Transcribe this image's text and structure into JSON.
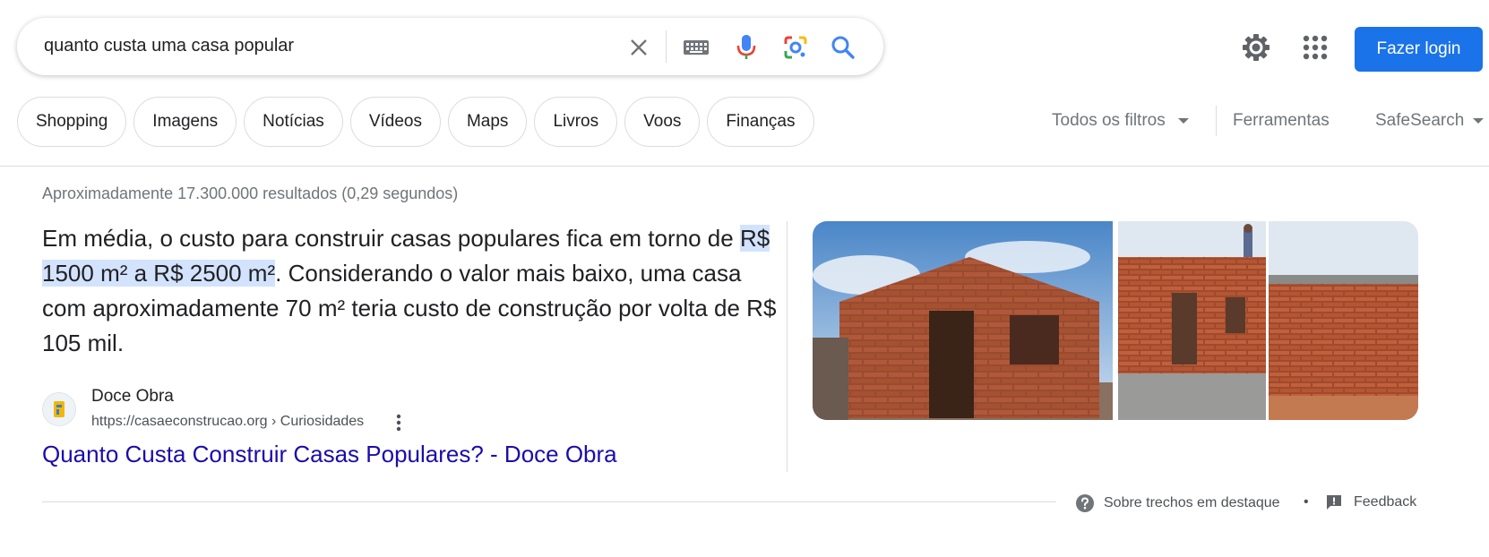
{
  "search": {
    "query": "quanto custa uma casa popular"
  },
  "header": {
    "login_label": "Fazer login"
  },
  "chips": [
    "Shopping",
    "Imagens",
    "Notícias",
    "Vídeos",
    "Maps",
    "Livros",
    "Voos",
    "Finanças"
  ],
  "filters": {
    "all_filters": "Todos os filtros",
    "tools": "Ferramentas",
    "safesearch": "SafeSearch"
  },
  "results": {
    "stats": "Aproximadamente 17.300.000 resultados (0,29 segundos)",
    "snippet_before": "Em média, o custo para construir casas populares fica em torno de ",
    "snippet_highlight": "R$ 1500 m² a R$ 2500 m²",
    "snippet_after": ". Considerando o valor mais baixo, uma casa com aproximadamente 70 m² teria custo de construção por volta de R$ 105 mil.",
    "source_name": "Doce Obra",
    "source_url": "https://casaeconstrucao.org › Curiosidades",
    "link_title": "Quanto Custa Construir Casas Populares? - Doce Obra"
  },
  "footer": {
    "about_snippets": "Sobre trechos em destaque",
    "feedback": "Feedback"
  },
  "colors": {
    "accent": "#1a73e8",
    "link": "#1a0dab",
    "highlight": "#d3e3fd"
  },
  "icons": [
    "close-icon",
    "keyboard-icon",
    "microphone-icon",
    "lens-icon",
    "search-icon",
    "gear-icon",
    "apps-icon",
    "kebab-icon",
    "help-icon",
    "feedback-icon"
  ]
}
